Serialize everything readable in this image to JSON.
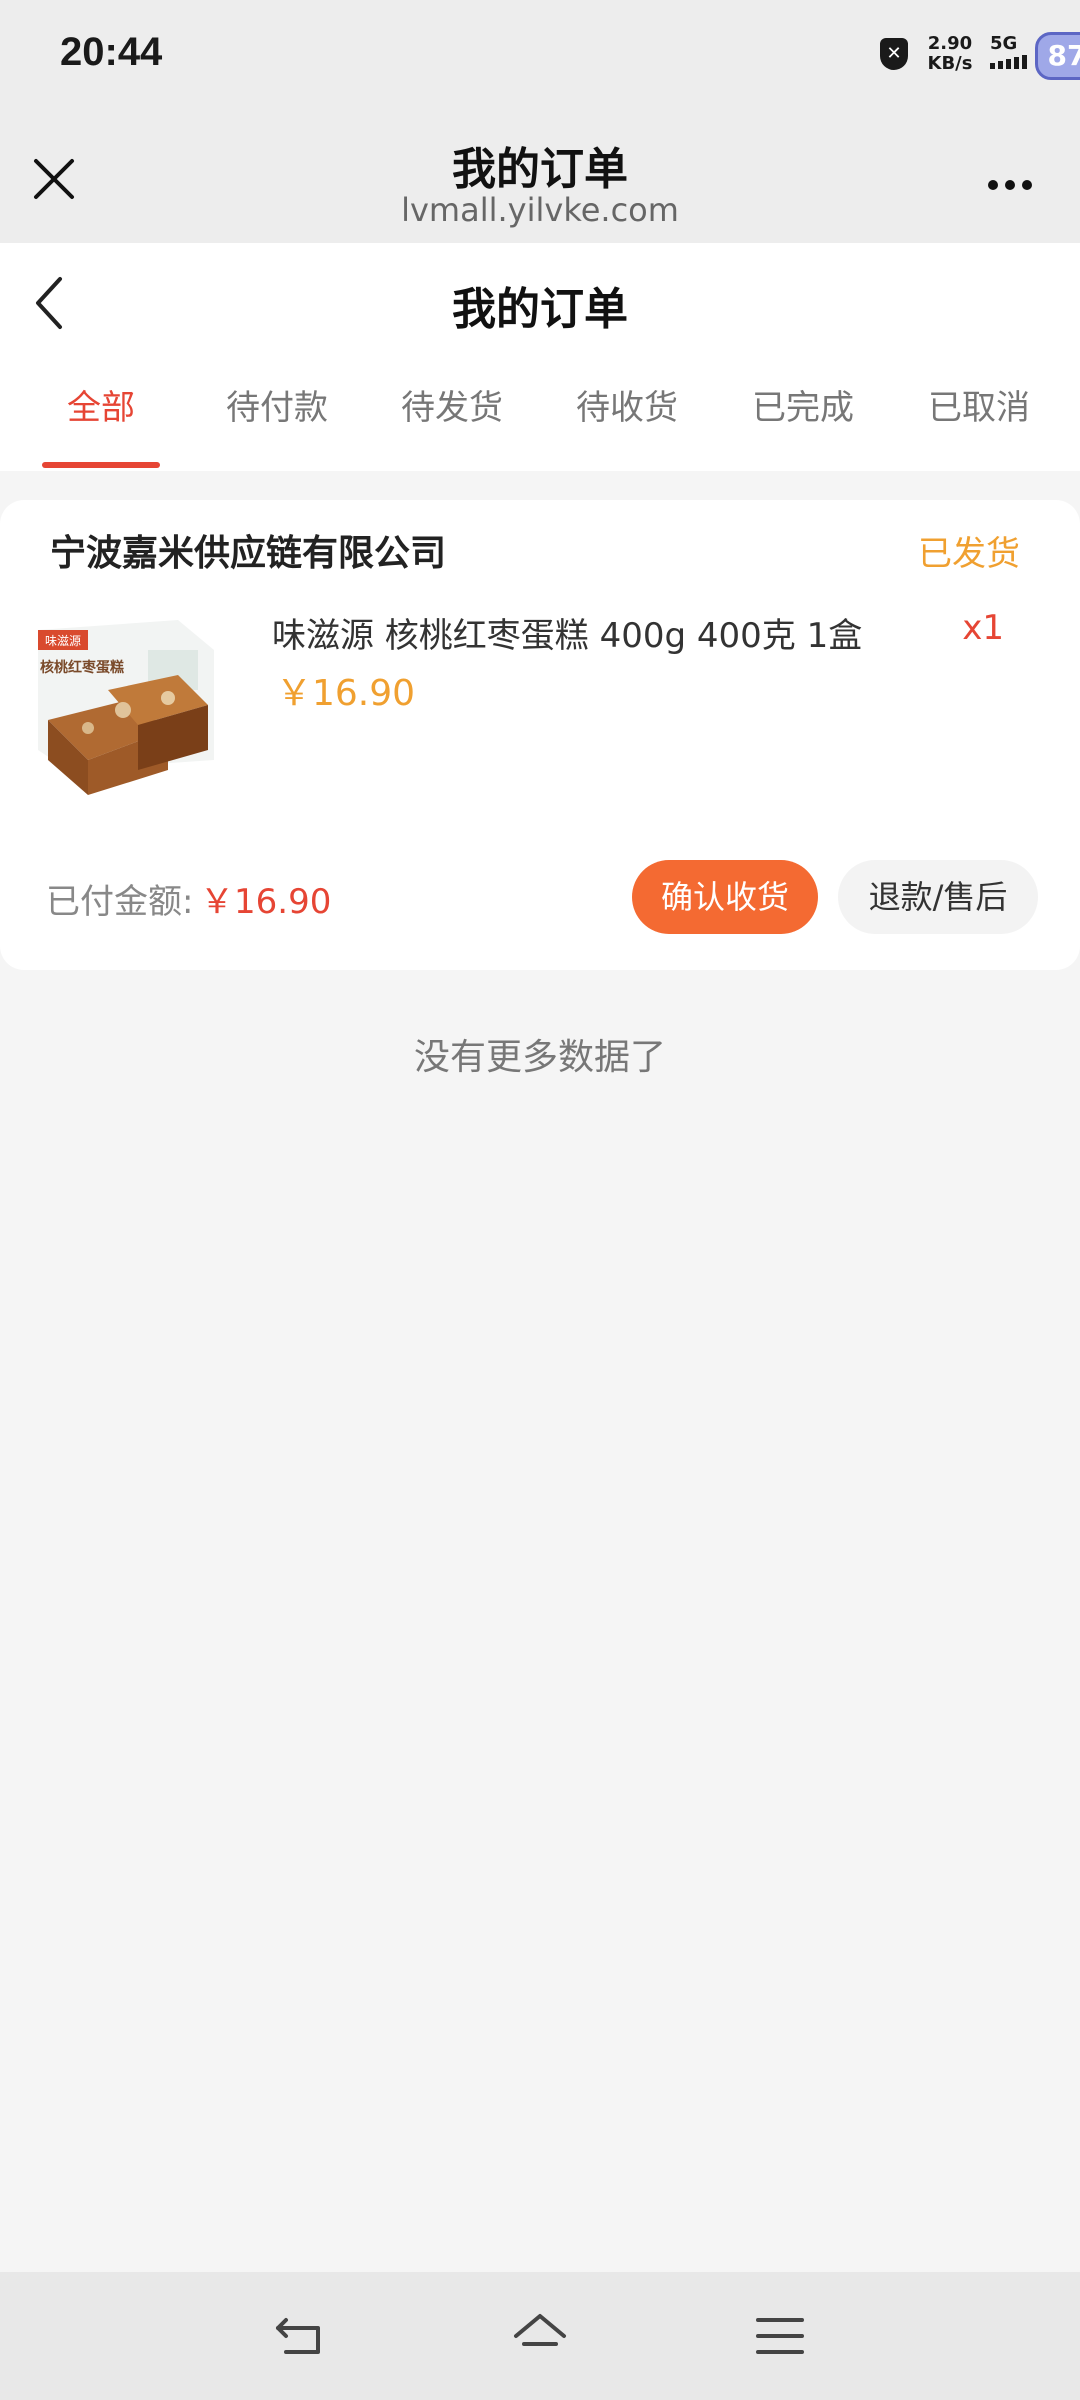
{
  "status_bar": {
    "time": "20:44",
    "net_speed_value": "2.90",
    "net_speed_unit": "KB/s",
    "network": "5G",
    "battery": "87"
  },
  "web_header": {
    "title": "我的订单",
    "url": "lvmall.yilvke.com"
  },
  "page": {
    "title": "我的订单",
    "tabs": [
      {
        "label": "全部",
        "active": true
      },
      {
        "label": "待付款",
        "active": false
      },
      {
        "label": "待发货",
        "active": false
      },
      {
        "label": "待收货",
        "active": false
      },
      {
        "label": "已完成",
        "active": false
      },
      {
        "label": "已取消",
        "active": false
      }
    ]
  },
  "order": {
    "shop_name": "宁波嘉米供应链有限公司",
    "status": "已发货",
    "product_name": "味滋源 核桃红枣蛋糕 400g 400克 1盒",
    "quantity": "x1",
    "price": "￥16.90",
    "paid_label": "已付金额:",
    "paid_amount": "￥16.90",
    "confirm_button": "确认收货",
    "refund_button": "退款/售后",
    "image_brand": "味滋源",
    "image_text": "核桃红枣蛋糕"
  },
  "footer_text": "没有更多数据了",
  "colors": {
    "accent_red": "#e64534",
    "status_orange": "#f0a030",
    "confirm_orange": "#f46a32"
  }
}
